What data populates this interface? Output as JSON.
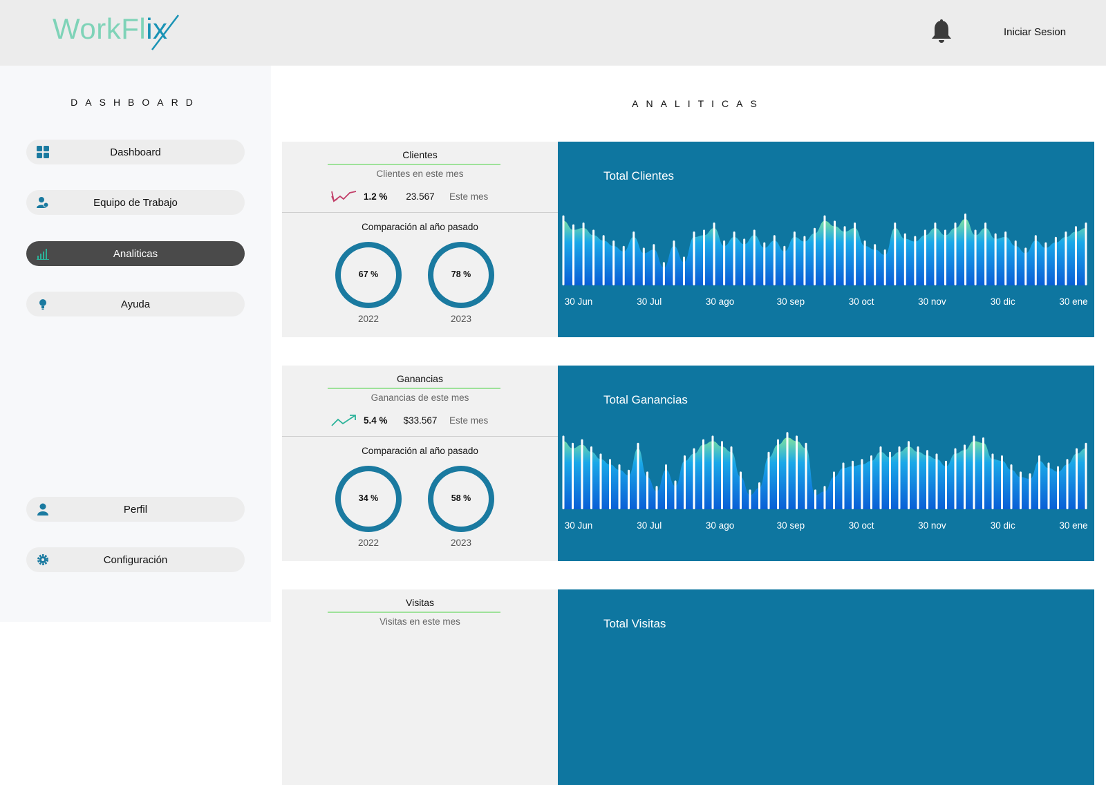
{
  "header": {
    "logo_work": "WorkFl",
    "logo_flix": "ix",
    "login_label": "Iniciar Sesion"
  },
  "icons": {
    "bell": "bell-icon",
    "dashboard": "grid-icon",
    "team": "users-icon",
    "analytics": "bar-chart-icon",
    "help": "lightbulb-icon",
    "profile": "user-icon",
    "settings": "gear-icon",
    "trend_down": "trend-down-icon",
    "trend_up": "trend-up-icon"
  },
  "colors": {
    "accent": "#1a7aa0",
    "chart_bg": "#0e76a0",
    "logo_light": "#7fd3b8",
    "logo_dark": "#1a93b5",
    "trend_down": "#c2406a",
    "trend_up": "#2bb39a",
    "underline": "#9ee29a",
    "active_nav": "#4a4a4a"
  },
  "sidebar": {
    "title": "DASHBOARD",
    "items": [
      {
        "label": "Dashboard"
      },
      {
        "label": "Equipo de Trabajo"
      },
      {
        "label": "Analiticas",
        "active": true
      },
      {
        "label": "Ayuda"
      },
      {
        "label": "Perfil"
      },
      {
        "label": "Configuración"
      }
    ]
  },
  "main": {
    "title": "ANALITICAS",
    "cards": [
      {
        "title": "Clientes",
        "subtitle": "Clientes en este mes",
        "trend": "down",
        "change": "1.2 %",
        "value": "23.567",
        "period": "Este mes",
        "comparison_title": "Comparación al año pasado",
        "rings": [
          {
            "value": "67 %",
            "progress": 0.67,
            "year": "2022"
          },
          {
            "value": "78 %",
            "progress": 0.78,
            "year": "2023"
          }
        ],
        "chart_title": "Total Clientes"
      },
      {
        "title": "Ganancias",
        "subtitle": "Ganancias de este mes",
        "trend": "up",
        "change": "5.4 %",
        "value": "$33.567",
        "period": "Este mes",
        "comparison_title": "Comparación al año pasado",
        "rings": [
          {
            "value": "34 %",
            "progress": 0.34,
            "year": "2022"
          },
          {
            "value": "58 %",
            "progress": 0.58,
            "year": "2023"
          }
        ],
        "chart_title": "Total Ganancias"
      },
      {
        "title": "Visitas",
        "subtitle": "Visitas en este mes",
        "chart_title": "Total Visitas"
      }
    ]
  },
  "chart_data": [
    {
      "type": "bar",
      "title": "Total Clientes",
      "x_ticks": [
        "30 Jun",
        "30 Jul",
        "30 ago",
        "30 sep",
        "30 oct",
        "30 nov",
        "30 dic",
        "30 ene"
      ],
      "values": [
        78,
        68,
        70,
        62,
        56,
        50,
        44,
        60,
        42,
        46,
        26,
        50,
        32,
        60,
        62,
        70,
        50,
        60,
        52,
        62,
        48,
        56,
        44,
        60,
        55,
        64,
        78,
        72,
        66,
        70,
        50,
        46,
        40,
        70,
        58,
        55,
        62,
        70,
        62,
        70,
        80,
        62,
        70,
        58,
        60,
        50,
        42,
        56,
        48,
        54,
        60,
        66,
        70
      ]
    },
    {
      "type": "bar",
      "title": "Total Ganancias",
      "x_ticks": [
        "30 Jun",
        "30 Jul",
        "30 ago",
        "30 sep",
        "30 oct",
        "30 nov",
        "30 dic",
        "30 ene"
      ],
      "values": [
        82,
        74,
        78,
        70,
        62,
        56,
        50,
        44,
        74,
        42,
        26,
        50,
        32,
        60,
        68,
        78,
        82,
        76,
        70,
        42,
        22,
        30,
        64,
        78,
        86,
        82,
        74,
        22,
        26,
        42,
        52,
        54,
        56,
        60,
        70,
        64,
        70,
        76,
        70,
        66,
        62,
        54,
        68,
        72,
        82,
        80,
        62,
        60,
        50,
        42,
        40,
        60,
        52,
        48,
        56,
        68,
        74
      ]
    }
  ]
}
